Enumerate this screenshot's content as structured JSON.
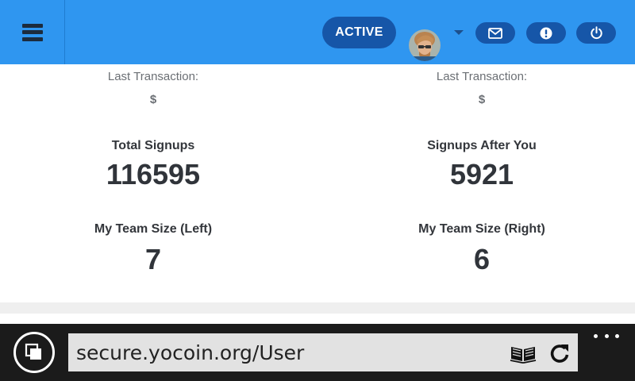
{
  "header": {
    "status": "ACTIVE",
    "menu_icon": "hamburger-menu-icon",
    "avatar_alt": "user-avatar",
    "buttons": [
      {
        "icon": "envelope-icon"
      },
      {
        "icon": "exclamation-icon"
      },
      {
        "icon": "power-icon"
      }
    ],
    "colors": {
      "bar": "#2f96f0",
      "pill": "#1656a8"
    }
  },
  "stats": {
    "left": {
      "last_transaction_label": "Last Transaction:",
      "last_transaction_value": "$",
      "primary_label": "Total Signups",
      "primary_value": "116595",
      "team_label": "My Team Size (Left)",
      "team_value": "7"
    },
    "right": {
      "last_transaction_label": "Last Transaction:",
      "last_transaction_value": "$",
      "primary_label": "Signups After You",
      "primary_value": "5921",
      "team_label": "My Team Size (Right)",
      "team_value": "6"
    }
  },
  "browser": {
    "url": "secure.yocoin.org/User",
    "tabs_icon": "tabs-icon",
    "reading_icon": "reading-view-icon",
    "refresh_icon": "refresh-icon",
    "more_icon": "more-icon"
  }
}
